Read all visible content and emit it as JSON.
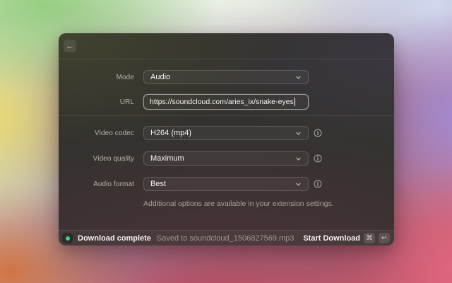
{
  "window": {
    "back_label": "←",
    "form": {
      "mode": {
        "label": "Mode",
        "value": "Audio"
      },
      "url": {
        "label": "URL",
        "value": "https://soundcloud.com/aries_ix/snake-eyes"
      },
      "video_codec": {
        "label": "Video codec",
        "value": "H264 (mp4)"
      },
      "video_quality": {
        "label": "Video quality",
        "value": "Maximum"
      },
      "audio_format": {
        "label": "Audio format",
        "value": "Best"
      },
      "note": "Additional options are available in your extension settings."
    },
    "status_bar": {
      "status_text": "Download complete",
      "detail_text": "Saved to soundcloud_1506827569.mp3",
      "action_label": "Start Download",
      "shortcut_cmd": "⌘",
      "shortcut_return": "↵"
    }
  },
  "colors": {
    "status_dot": "#36d483"
  }
}
